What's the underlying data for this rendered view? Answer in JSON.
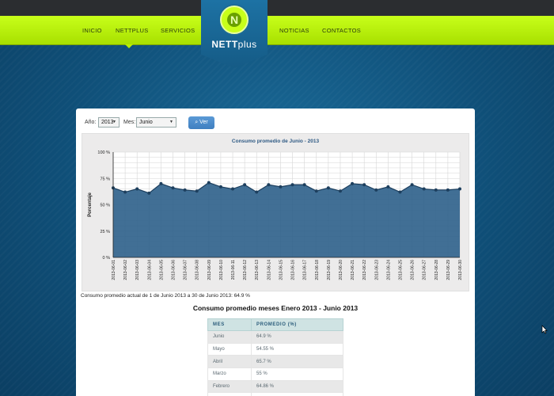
{
  "nav": {
    "items": [
      "INICIO",
      "NETTPLUS",
      "SERVICIOS",
      "NOTICIAS",
      "CONTACTOS"
    ],
    "active": "NETTPLUS"
  },
  "logo": {
    "letter": "N",
    "brand_bold": "NETT",
    "brand_light": "plus"
  },
  "filters": {
    "year_label": "Año:",
    "year_value": "2013",
    "month_label": "Mes:",
    "month_value": "Junio",
    "submit_label": "Ver"
  },
  "chart_data": {
    "type": "area",
    "title": "Consumo promedio de Junio - 2013",
    "ylabel": "Porcentaje",
    "xlabel": "",
    "ylim": [
      0,
      100
    ],
    "yticks": [
      "0 %",
      "25 %",
      "50 %",
      "75 %",
      "100 %"
    ],
    "grid": true,
    "x": [
      "2013-06-01",
      "2013-06-02",
      "2013-06-03",
      "2013-06-04",
      "2013-06-05",
      "2013-06-06",
      "2013-06-07",
      "2013-06-08",
      "2013-06-09",
      "2013-06-10",
      "2013-06-11",
      "2013-06-12",
      "2013-06-13",
      "2013-06-14",
      "2013-06-15",
      "2013-06-16",
      "2013-06-17",
      "2013-06-18",
      "2013-06-19",
      "2013-06-20",
      "2013-06-21",
      "2013-06-22",
      "2013-06-23",
      "2013-06-24",
      "2013-06-25",
      "2013-06-26",
      "2013-06-27",
      "2013-06-28",
      "2013-06-29",
      "2013-06-30"
    ],
    "values": [
      66,
      62,
      65,
      61,
      70,
      66,
      64,
      63,
      71,
      67,
      65,
      69,
      62,
      69,
      67,
      69,
      69,
      63,
      66,
      63,
      70,
      69,
      64,
      67,
      62,
      69,
      65,
      64,
      64,
      65
    ],
    "colors": {
      "fill": "#2c5f89",
      "line": "#1d3f5e",
      "point": "#1d3f5e",
      "grid": "#d6d6d6",
      "plot_bg": "#ffffff"
    }
  },
  "caption": "Consumo promedio actual de 1 de Junio 2013 a 30 de Junio 2013: 64.9 %",
  "summary": {
    "title": "Consumo promedio meses Enero 2013 - Junio 2013",
    "headers": [
      "MES",
      "PROMEDIO (%)"
    ],
    "rows": [
      [
        "Junio",
        "64.9 %"
      ],
      [
        "Mayo",
        "54.55 %"
      ],
      [
        "Abril",
        "65.7 %"
      ],
      [
        "Marzo",
        "55 %"
      ],
      [
        "Febrero",
        "64.86 %"
      ],
      [
        "",
        ""
      ]
    ]
  }
}
